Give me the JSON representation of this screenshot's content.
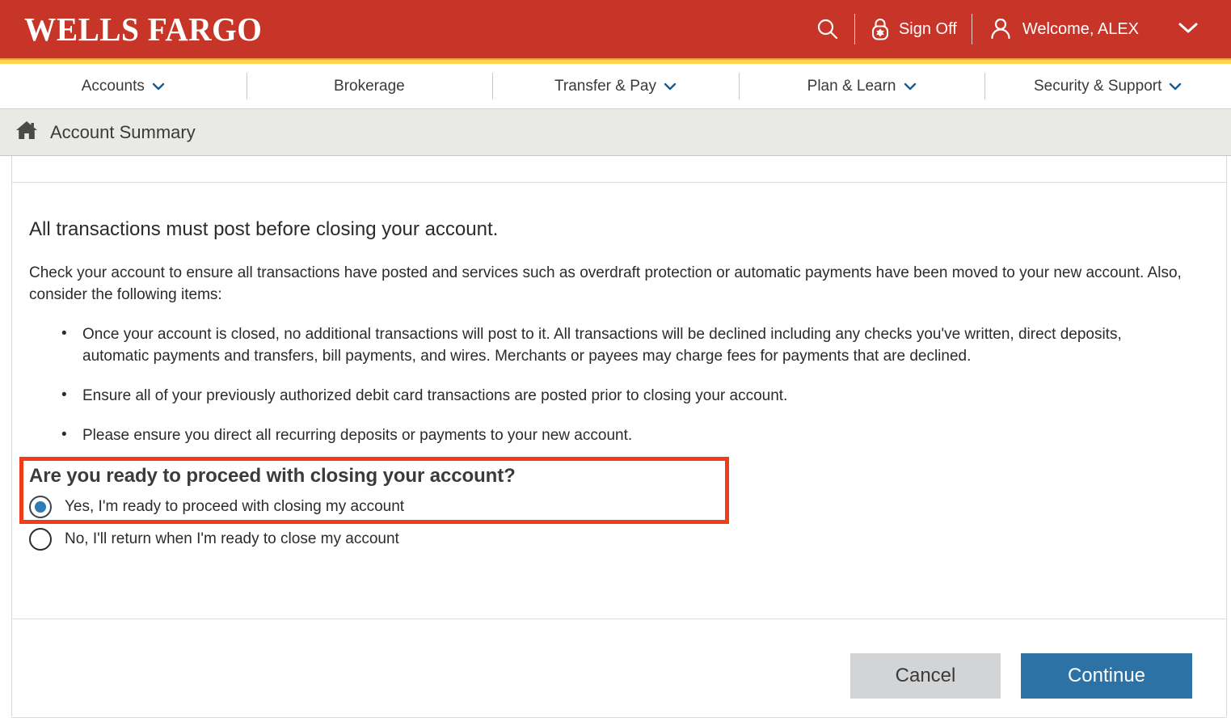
{
  "header": {
    "logo": "WELLS FARGO",
    "search_icon": "search-icon",
    "sign_off_label": "Sign Off",
    "sign_off_icon": "lock-icon",
    "welcome_label": "Welcome, ALEX",
    "account_icon": "person-icon",
    "chevron_icon": "chevron-down-icon",
    "bg_color": "#C63527",
    "accent_color": "#FFD24F"
  },
  "nav": {
    "items": [
      {
        "label": "Accounts",
        "has_chevron": true
      },
      {
        "label": "Brokerage",
        "has_chevron": false
      },
      {
        "label": "Transfer & Pay",
        "has_chevron": true
      },
      {
        "label": "Plan & Learn",
        "has_chevron": true
      },
      {
        "label": "Security & Support",
        "has_chevron": true
      }
    ]
  },
  "breadcrumb": {
    "home_icon": "home-icon",
    "label": "Account Summary"
  },
  "main": {
    "lead_heading": "All transactions must post before closing your account.",
    "paragraph": "Check your account to ensure all transactions have posted and services such as overdraft protection or automatic payments have been moved to your new account. Also, consider the following items:",
    "bullets": [
      "Once your account is closed, no additional transactions will post to it. All transactions will be declined including any checks you've written, direct deposits, automatic payments and transfers, bill payments, and wires. Merchants or payees may charge fees for payments that are declined.",
      "Ensure all of your previously authorized debit card transactions are posted prior to closing your account.",
      "Please ensure you direct all recurring deposits or payments to your new account."
    ],
    "question": {
      "title": "Are you ready to proceed with closing your account?",
      "highlight_color": "#F03C18",
      "options": [
        {
          "label": "Yes, I'm ready to proceed with closing my account",
          "selected": true
        },
        {
          "label": "No, I'll return when I'm ready to close my account",
          "selected": false
        }
      ]
    }
  },
  "footer": {
    "cancel_label": "Cancel",
    "continue_label": "Continue",
    "continue_color": "#2D72A5",
    "cancel_color": "#D3D4D6"
  }
}
